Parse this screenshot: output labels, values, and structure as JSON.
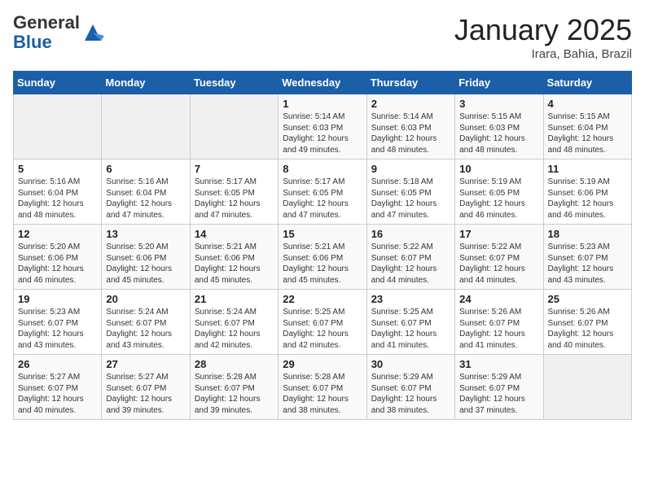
{
  "header": {
    "logo_line1": "General",
    "logo_line2": "Blue",
    "title": "January 2025",
    "subtitle": "Irara, Bahia, Brazil"
  },
  "weekdays": [
    "Sunday",
    "Monday",
    "Tuesday",
    "Wednesday",
    "Thursday",
    "Friday",
    "Saturday"
  ],
  "weeks": [
    [
      {
        "day": "",
        "info": ""
      },
      {
        "day": "",
        "info": ""
      },
      {
        "day": "",
        "info": ""
      },
      {
        "day": "1",
        "info": "Sunrise: 5:14 AM\nSunset: 6:03 PM\nDaylight: 12 hours\nand 49 minutes."
      },
      {
        "day": "2",
        "info": "Sunrise: 5:14 AM\nSunset: 6:03 PM\nDaylight: 12 hours\nand 48 minutes."
      },
      {
        "day": "3",
        "info": "Sunrise: 5:15 AM\nSunset: 6:03 PM\nDaylight: 12 hours\nand 48 minutes."
      },
      {
        "day": "4",
        "info": "Sunrise: 5:15 AM\nSunset: 6:04 PM\nDaylight: 12 hours\nand 48 minutes."
      }
    ],
    [
      {
        "day": "5",
        "info": "Sunrise: 5:16 AM\nSunset: 6:04 PM\nDaylight: 12 hours\nand 48 minutes."
      },
      {
        "day": "6",
        "info": "Sunrise: 5:16 AM\nSunset: 6:04 PM\nDaylight: 12 hours\nand 47 minutes."
      },
      {
        "day": "7",
        "info": "Sunrise: 5:17 AM\nSunset: 6:05 PM\nDaylight: 12 hours\nand 47 minutes."
      },
      {
        "day": "8",
        "info": "Sunrise: 5:17 AM\nSunset: 6:05 PM\nDaylight: 12 hours\nand 47 minutes."
      },
      {
        "day": "9",
        "info": "Sunrise: 5:18 AM\nSunset: 6:05 PM\nDaylight: 12 hours\nand 47 minutes."
      },
      {
        "day": "10",
        "info": "Sunrise: 5:19 AM\nSunset: 6:05 PM\nDaylight: 12 hours\nand 46 minutes."
      },
      {
        "day": "11",
        "info": "Sunrise: 5:19 AM\nSunset: 6:06 PM\nDaylight: 12 hours\nand 46 minutes."
      }
    ],
    [
      {
        "day": "12",
        "info": "Sunrise: 5:20 AM\nSunset: 6:06 PM\nDaylight: 12 hours\nand 46 minutes."
      },
      {
        "day": "13",
        "info": "Sunrise: 5:20 AM\nSunset: 6:06 PM\nDaylight: 12 hours\nand 45 minutes."
      },
      {
        "day": "14",
        "info": "Sunrise: 5:21 AM\nSunset: 6:06 PM\nDaylight: 12 hours\nand 45 minutes."
      },
      {
        "day": "15",
        "info": "Sunrise: 5:21 AM\nSunset: 6:06 PM\nDaylight: 12 hours\nand 45 minutes."
      },
      {
        "day": "16",
        "info": "Sunrise: 5:22 AM\nSunset: 6:07 PM\nDaylight: 12 hours\nand 44 minutes."
      },
      {
        "day": "17",
        "info": "Sunrise: 5:22 AM\nSunset: 6:07 PM\nDaylight: 12 hours\nand 44 minutes."
      },
      {
        "day": "18",
        "info": "Sunrise: 5:23 AM\nSunset: 6:07 PM\nDaylight: 12 hours\nand 43 minutes."
      }
    ],
    [
      {
        "day": "19",
        "info": "Sunrise: 5:23 AM\nSunset: 6:07 PM\nDaylight: 12 hours\nand 43 minutes."
      },
      {
        "day": "20",
        "info": "Sunrise: 5:24 AM\nSunset: 6:07 PM\nDaylight: 12 hours\nand 43 minutes."
      },
      {
        "day": "21",
        "info": "Sunrise: 5:24 AM\nSunset: 6:07 PM\nDaylight: 12 hours\nand 42 minutes."
      },
      {
        "day": "22",
        "info": "Sunrise: 5:25 AM\nSunset: 6:07 PM\nDaylight: 12 hours\nand 42 minutes."
      },
      {
        "day": "23",
        "info": "Sunrise: 5:25 AM\nSunset: 6:07 PM\nDaylight: 12 hours\nand 41 minutes."
      },
      {
        "day": "24",
        "info": "Sunrise: 5:26 AM\nSunset: 6:07 PM\nDaylight: 12 hours\nand 41 minutes."
      },
      {
        "day": "25",
        "info": "Sunrise: 5:26 AM\nSunset: 6:07 PM\nDaylight: 12 hours\nand 40 minutes."
      }
    ],
    [
      {
        "day": "26",
        "info": "Sunrise: 5:27 AM\nSunset: 6:07 PM\nDaylight: 12 hours\nand 40 minutes."
      },
      {
        "day": "27",
        "info": "Sunrise: 5:27 AM\nSunset: 6:07 PM\nDaylight: 12 hours\nand 39 minutes."
      },
      {
        "day": "28",
        "info": "Sunrise: 5:28 AM\nSunset: 6:07 PM\nDaylight: 12 hours\nand 39 minutes."
      },
      {
        "day": "29",
        "info": "Sunrise: 5:28 AM\nSunset: 6:07 PM\nDaylight: 12 hours\nand 38 minutes."
      },
      {
        "day": "30",
        "info": "Sunrise: 5:29 AM\nSunset: 6:07 PM\nDaylight: 12 hours\nand 38 minutes."
      },
      {
        "day": "31",
        "info": "Sunrise: 5:29 AM\nSunset: 6:07 PM\nDaylight: 12 hours\nand 37 minutes."
      },
      {
        "day": "",
        "info": ""
      }
    ]
  ]
}
